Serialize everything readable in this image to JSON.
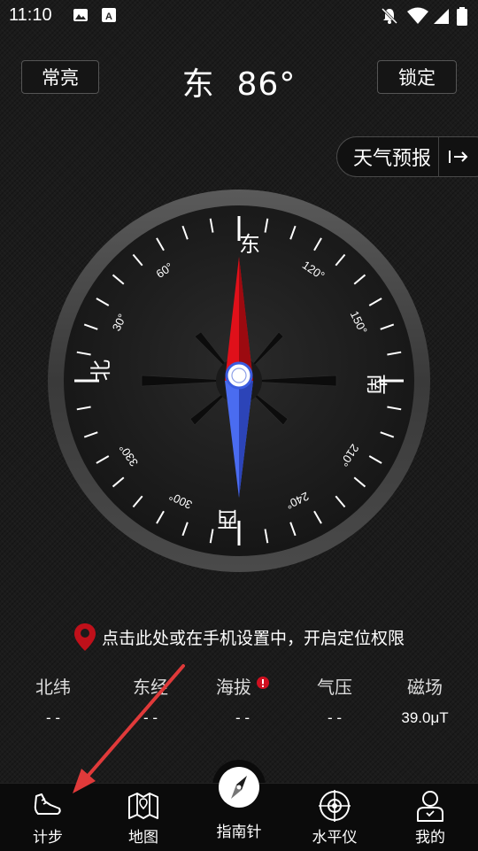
{
  "status_bar": {
    "time": "11:10"
  },
  "header": {
    "left_button": "常亮",
    "heading": "东  86°",
    "right_button": "锁定"
  },
  "weather": {
    "label": "天气预报",
    "arrow_icon": "arrow-right-bar-icon"
  },
  "compass": {
    "direction_labels": {
      "top": "东",
      "right": "南",
      "bottom": "西",
      "left": "北"
    },
    "degree_labels": [
      "60°",
      "30°",
      "120°",
      "150°",
      "210°",
      "240°",
      "300°",
      "330°"
    ],
    "needle_colors": {
      "north": "#e0101a",
      "south": "#3b5ce0"
    }
  },
  "location_prompt": {
    "text": "点击此处或在手机设置中，开启定位权限",
    "icon": "location-pin-icon",
    "color": "#c0101a"
  },
  "info": [
    {
      "label": "北纬",
      "value": "- -"
    },
    {
      "label": "东经",
      "value": "- -"
    },
    {
      "label": "海拔",
      "value": "- -",
      "alert": true
    },
    {
      "label": "气压",
      "value": "- -"
    },
    {
      "label": "磁场",
      "value": "39.0μT"
    }
  ],
  "bottom_nav": [
    {
      "label": "计步",
      "icon": "shoe-icon"
    },
    {
      "label": "地图",
      "icon": "map-icon"
    },
    {
      "label": "指南针",
      "icon": "compass-icon"
    },
    {
      "label": "水平仪",
      "icon": "level-icon"
    },
    {
      "label": "我的",
      "icon": "user-icon"
    }
  ],
  "annotation": {
    "color": "#e03a3a"
  }
}
